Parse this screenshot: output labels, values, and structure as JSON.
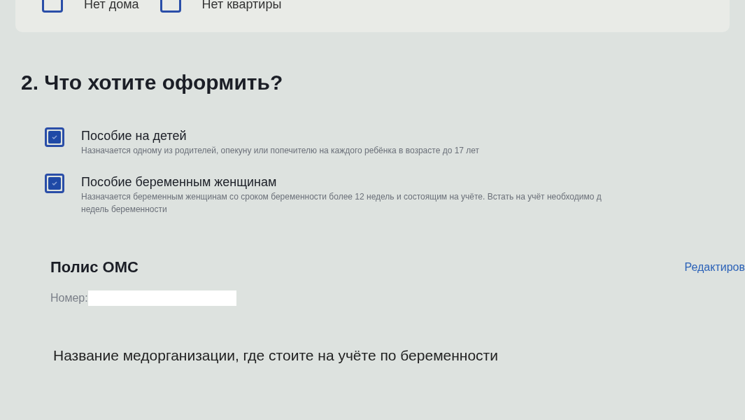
{
  "top_options": [
    {
      "label": "Нет дома",
      "checked": false
    },
    {
      "label": "Нет квартиры",
      "checked": false
    }
  ],
  "section": {
    "title": "2. Что хотите оформить?",
    "options": [
      {
        "label": "Пособие на детей",
        "description": "Назначается одному из родителей, опекуну или попечителю на каждого ребёнка в возрасте до 17 лет",
        "checked": true
      },
      {
        "label": "Пособие беременным женщинам",
        "description": "Назначается беременным женщинам со сроком беременности более 12 недель и состоящим на учёте. Встать на учёт необходимо д",
        "description_2": "недель беременности",
        "checked": true
      }
    ]
  },
  "policy": {
    "title": "Полис ОМС",
    "edit_link": "Редактиров",
    "number_label": "Номер:"
  },
  "clinic": {
    "label": "Название медорганизации, где стоите на учёте по беременности"
  }
}
